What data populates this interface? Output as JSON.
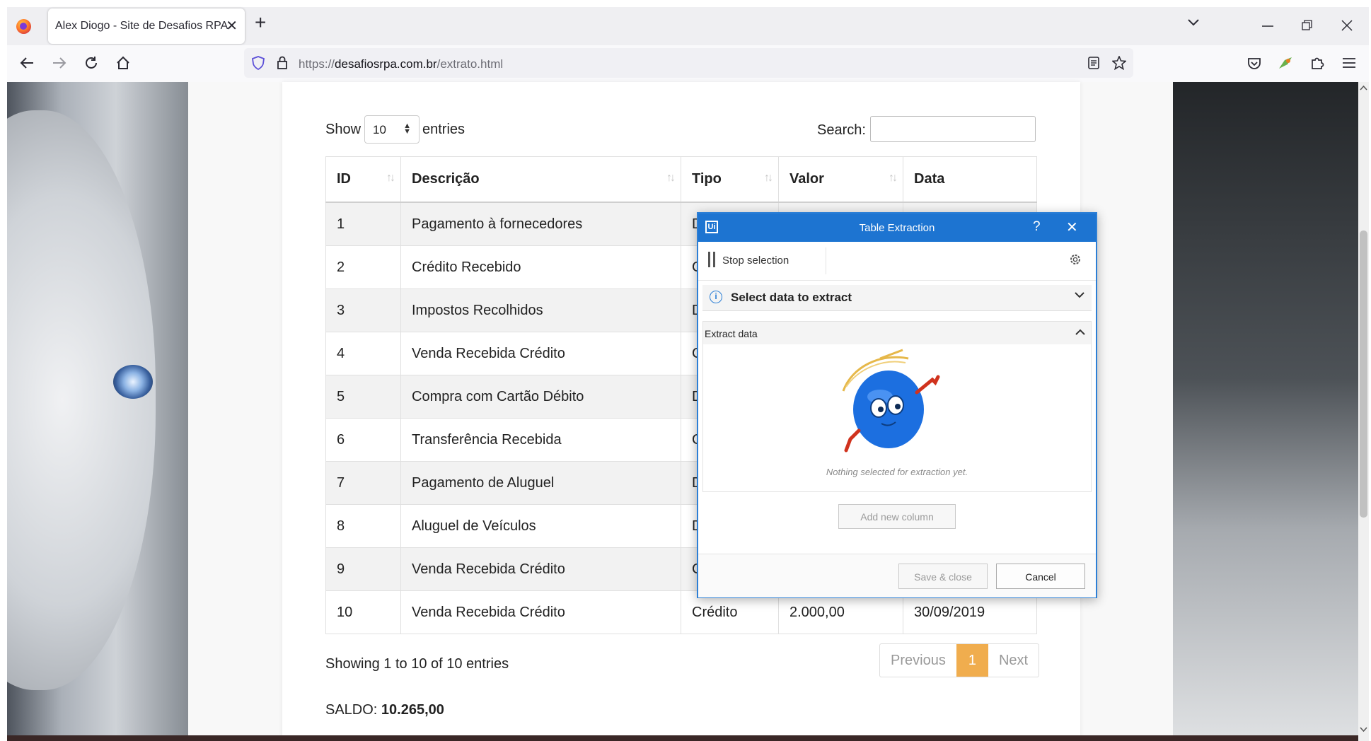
{
  "browser": {
    "tab_title": "Alex Diogo - Site de Desafios RPA",
    "tab_close": "✕",
    "new_tab": "+",
    "url_scheme": "https://",
    "url_domain": "desafiosrpa.com.br",
    "url_path": "/extrato.html"
  },
  "table_controls": {
    "show_label": "Show",
    "entries_value": "10",
    "entries_label": "entries",
    "search_label": "Search:"
  },
  "table": {
    "columns": [
      "ID",
      "Descrição",
      "Tipo",
      "Valor",
      "Data"
    ],
    "rows": [
      {
        "id": "1",
        "desc": "Pagamento à fornecedores",
        "tipo": "D",
        "valor": "",
        "data": ""
      },
      {
        "id": "2",
        "desc": "Crédito Recebido",
        "tipo": "C",
        "valor": "",
        "data": ""
      },
      {
        "id": "3",
        "desc": "Impostos Recolhidos",
        "tipo": "D",
        "valor": "",
        "data": ""
      },
      {
        "id": "4",
        "desc": "Venda Recebida Crédito",
        "tipo": "C",
        "valor": "",
        "data": ""
      },
      {
        "id": "5",
        "desc": "Compra com Cartão Débito",
        "tipo": "D",
        "valor": "",
        "data": ""
      },
      {
        "id": "6",
        "desc": "Transferência Recebida",
        "tipo": "C",
        "valor": "",
        "data": ""
      },
      {
        "id": "7",
        "desc": "Pagamento de Aluguel",
        "tipo": "D",
        "valor": "",
        "data": ""
      },
      {
        "id": "8",
        "desc": "Aluguel de Veículos",
        "tipo": "D",
        "valor": "",
        "data": ""
      },
      {
        "id": "9",
        "desc": "Venda Recebida Crédito",
        "tipo": "C",
        "valor": "",
        "data": ""
      },
      {
        "id": "10",
        "desc": "Venda Recebida Crédito",
        "tipo": "Crédito",
        "valor": "2.000,00",
        "data": "30/09/2019"
      }
    ]
  },
  "footer": {
    "info": "Showing 1 to 10 of 10 entries",
    "prev": "Previous",
    "page": "1",
    "next": "Next",
    "saldo_label": "SALDO:",
    "saldo_value": "10.265,00"
  },
  "dialog": {
    "logo": "Ui",
    "title": "Table Extraction",
    "help": "?",
    "close": "✕",
    "stop_label": "Stop selection",
    "select_label": "Select data to extract",
    "extract_label": "Extract data",
    "empty_text": "Nothing selected for extraction yet.",
    "add_column": "Add new column",
    "save_close": "Save & close",
    "cancel": "Cancel"
  },
  "colors": {
    "dialog_blue": "#1d74d1",
    "page_active": "#f0ad4e",
    "mascot_blue": "#1c6fe0",
    "mascot_red": "#d0321d"
  }
}
